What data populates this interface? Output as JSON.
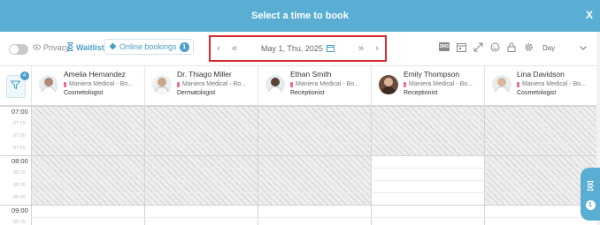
{
  "modal": {
    "title": "Select a time to book",
    "close_label": "X"
  },
  "toolbar": {
    "privacy_label": "Privacy",
    "waitlist_label": "Waitlist",
    "online_bookings_label": "Online bookings",
    "online_bookings_count": "1",
    "date": "May 1, Thu, 2025",
    "prev_day": "‹",
    "prev_week": "«",
    "next_week": "»",
    "next_day": "›",
    "sms_label": "SMS",
    "view_select": "Day"
  },
  "filter": {
    "badge": "4"
  },
  "staff": [
    {
      "name": "Amelia Hernandez",
      "location": "Maniera Medical - Bo...",
      "role": "Cosmetologist"
    },
    {
      "name": "Dr. Thiago Miller",
      "location": "Maniera Medical - Bo...",
      "role": "Dermatologist"
    },
    {
      "name": "Ethan Smith",
      "location": "Maniera Medical - Bo...",
      "role": "Receptionist"
    },
    {
      "name": "Emily Thompson",
      "location": "Maniera Medical - Bo...",
      "role": "Receptionist"
    },
    {
      "name": "Lina Davidson",
      "location": "Maniera Medical - Bo...",
      "role": "Cosmetologist"
    }
  ],
  "times": {
    "h0700": "07:00",
    "m0715": "07:15",
    "m0730": "07:30",
    "m0745": "07:45",
    "h0800": "08:00",
    "m0815": "08:15",
    "m0830": "08:30",
    "m0845": "08:45",
    "h0900": "09:00",
    "m0915": "09:15"
  },
  "side_widget": {
    "badge": "1"
  },
  "colors": {
    "accent": "#5aaed4",
    "highlight_border": "#d9262c",
    "location_pin": "#e86b8f"
  }
}
